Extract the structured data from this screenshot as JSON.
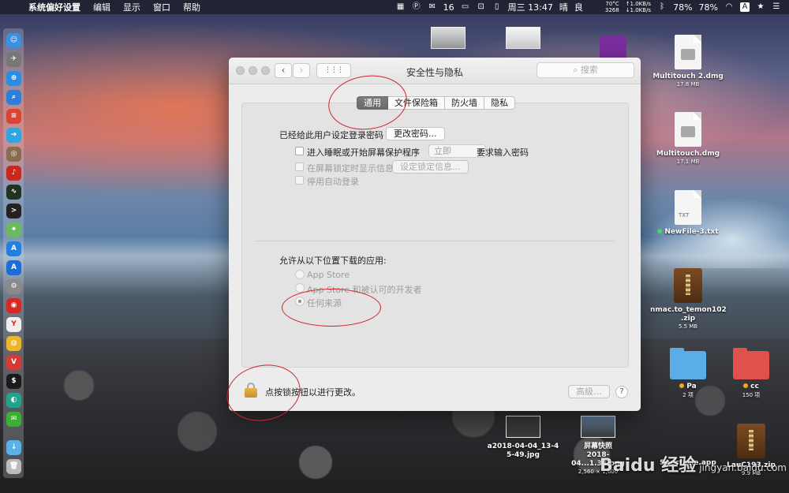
{
  "menubar": {
    "app_name": "系统偏好设置",
    "menus": [
      "编辑",
      "显示",
      "窗口",
      "帮助"
    ],
    "wechat_count": "16",
    "datetime": "周三 13:47",
    "weather": "晴",
    "air": "良",
    "sensor": "70°C\n3268",
    "network": "↑1.0KB/s\n↓1.0KB/s",
    "battery1": "78%",
    "battery2": "78%",
    "input_method": "A"
  },
  "window": {
    "title": "安全性与隐私",
    "search_placeholder": "搜索",
    "nav_back": "‹",
    "nav_forward": "›",
    "grid": "⋮⋮⋮",
    "tabs": [
      {
        "label": "通用",
        "active": true
      },
      {
        "label": "文件保险箱",
        "active": false
      },
      {
        "label": "防火墙",
        "active": false
      },
      {
        "label": "隐私",
        "active": false
      }
    ],
    "general": {
      "password_set_label": "已经给此用户设定登录密码",
      "change_password_button": "更改密码...",
      "require_password_label": "进入睡眠或开始屏幕保护程序",
      "require_delay_value": "立即",
      "require_password_suffix": "要求输入密码",
      "show_message_label": "在屏幕锁定时显示信息",
      "set_lock_message_button": "设定锁定信息...",
      "disable_autologin_label": "停用自动登录",
      "allow_apps_heading": "允许从以下位置下载的应用:",
      "sources": [
        {
          "label": "App Store",
          "selected": false
        },
        {
          "label": "App Store 和被认可的开发者",
          "selected": false
        },
        {
          "label": "任何来源",
          "selected": true
        }
      ]
    },
    "footer": {
      "lock_text": "点按锁按钮以进行更改。",
      "advanced_button": "高级...",
      "help_button": "?"
    }
  },
  "desktop": {
    "items": [
      {
        "name": "Multitouch 2.dmg",
        "size": "17.8 MB"
      },
      {
        "name": "Multitouch.dmg",
        "size": "17.1 MB"
      },
      {
        "name": "NewFile-3.txt",
        "size": "",
        "icon_text": "TXT"
      },
      {
        "name": "nmac.to_temon102\n.zip",
        "size": "5.5 MB"
      },
      {
        "name": "Pa",
        "size": "2 项"
      },
      {
        "name": "cc",
        "size": "150 项"
      },
      {
        "name": "a2018-04-04_13-4\n5-49.jpg",
        "size": ""
      },
      {
        "name": "屏幕快照\n2018-04...1.38.png",
        "size": "2,560 × 1,600"
      },
      {
        "name": "Spectacle.app",
        "size": ""
      },
      {
        "name": "LauC193.zip",
        "size": "9.9 MB"
      }
    ],
    "watermark": "Baidu 经验",
    "watermark_url": "jingyan.baidu.com"
  },
  "colors": {
    "annotation": "#d2222d",
    "tab_active": "#6a6a6a",
    "folder_blue": "#5aaee8",
    "folder_red": "#e0514e",
    "tag_orange": "#f5a623",
    "tag_green": "#4cd964"
  },
  "icons": {
    "apple": "apple-icon",
    "search": "magnifier-icon",
    "lock": "padlock-icon",
    "wifi": "wifi-icon",
    "bluetooth": "bluetooth-icon"
  }
}
